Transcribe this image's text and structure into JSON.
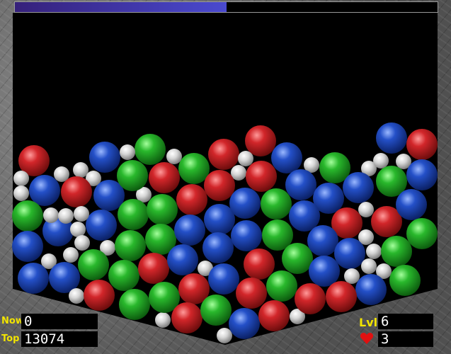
{
  "hud": {
    "now_label": "Now",
    "now_value": "0",
    "top_label": "Top",
    "top_value": "13074",
    "level_label": "Lvl",
    "level_value": "6",
    "lives_value": "3"
  },
  "progress": {
    "fraction": 0.5
  },
  "colors": {
    "red": "#d2262a",
    "green": "#29b82c",
    "blue": "#2450c8",
    "white": "#cfcfcf",
    "heart": "#e01010",
    "label": "#f2e400"
  }
}
